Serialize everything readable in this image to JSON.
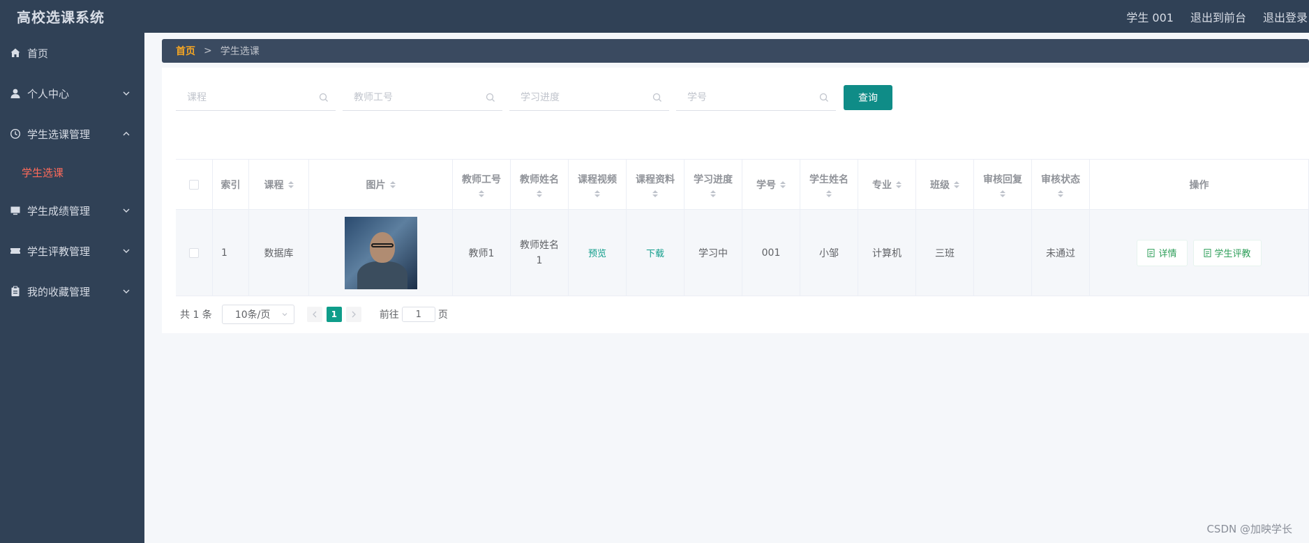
{
  "header": {
    "title": "高校选课系统",
    "user": "学生 001",
    "back_front": "退出到前台",
    "logout": "退出登录"
  },
  "sidebar": {
    "items": [
      {
        "label": "首页",
        "icon": "home-icon"
      },
      {
        "label": "个人中心",
        "icon": "user-icon"
      },
      {
        "label": "学生选课管理",
        "icon": "clock-icon",
        "expanded": true,
        "children": [
          {
            "label": "学生选课",
            "active": true
          }
        ]
      },
      {
        "label": "学生成绩管理",
        "icon": "monitor-icon"
      },
      {
        "label": "学生评教管理",
        "icon": "ticket-icon"
      },
      {
        "label": "我的收藏管理",
        "icon": "clipboard-icon"
      }
    ]
  },
  "breadcrumb": {
    "home": "首页",
    "separator": ">",
    "current": "学生选课"
  },
  "search": {
    "course_placeholder": "课程",
    "teacher_id_placeholder": "教师工号",
    "progress_placeholder": "学习进度",
    "student_id_placeholder": "学号",
    "query_label": "查询"
  },
  "table": {
    "columns": [
      "索引",
      "课程",
      "图片",
      "教师工号",
      "教师姓名",
      "课程视频",
      "课程资料",
      "学习进度",
      "学号",
      "学生姓名",
      "专业",
      "班级",
      "审核回复",
      "审核状态",
      "操作"
    ],
    "rows": [
      {
        "index": "1",
        "course": "数据库",
        "teacher_id": "教师1",
        "teacher_name": "教师姓名1",
        "video": "预览",
        "material": "下载",
        "progress": "学习中",
        "student_id": "001",
        "student_name": "小邹",
        "major": "计算机",
        "class": "三班",
        "reply": "",
        "status": "未通过",
        "actions": {
          "detail": "详情",
          "evaluate": "学生评教"
        }
      }
    ]
  },
  "pagination": {
    "total": "共 1 条",
    "page_size": "10条/页",
    "current_page": "1",
    "goto_prefix": "前往",
    "goto_value": "1",
    "goto_suffix": "页"
  },
  "watermark": "CSDN @加映学长",
  "colors": {
    "sidebar_bg": "#304156",
    "accent": "#0f8c87",
    "active_menu": "#ff6b5b",
    "breadcrumb_home": "#f5a623"
  }
}
